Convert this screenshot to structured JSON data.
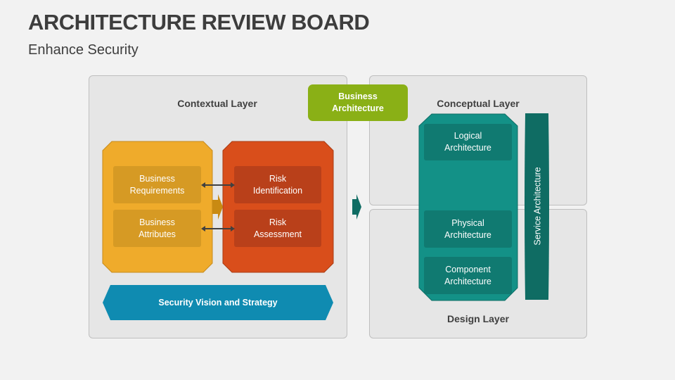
{
  "header": {
    "title": "ARCHITECTURE REVIEW BOARD",
    "subtitle": "Enhance Security"
  },
  "contextual": {
    "label": "Contextual Layer",
    "business_box": {
      "items": [
        "Business Requirements",
        "Business Attributes"
      ],
      "color": "#efab2b",
      "inner_color": "#d69a24"
    },
    "risk_box": {
      "items": [
        "Risk Identification",
        "Risk Assessment"
      ],
      "color": "#d94e1b",
      "inner_color": "#b9401a"
    },
    "strategy": {
      "label": "Security Vision and Strategy",
      "color": "#0f8bb1"
    }
  },
  "business_architecture": {
    "label": "Business Architecture",
    "color": "#8ab016"
  },
  "conceptual": {
    "label": "Conceptual Layer"
  },
  "design": {
    "label": "Design Layer"
  },
  "architecture_column": {
    "items": [
      "Logical Architecture",
      "Physical Architecture",
      "Component Architecture"
    ],
    "color": "#139187",
    "inner_color": "#107a71"
  },
  "service_architecture": {
    "label": "Service Architecture",
    "color": "#0f6c63"
  }
}
